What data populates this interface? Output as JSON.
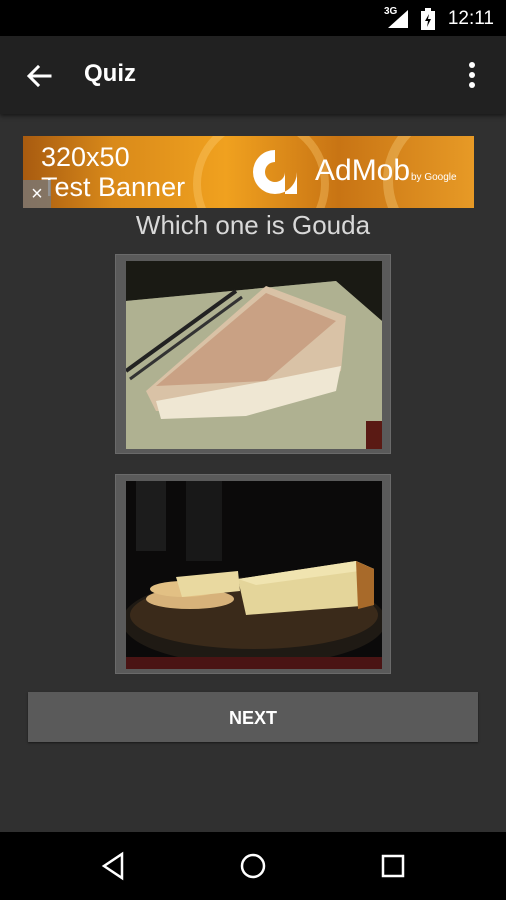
{
  "status_bar": {
    "network": "3G",
    "time": "12:11",
    "icons": [
      "signal-icon",
      "battery-icon"
    ]
  },
  "app_bar": {
    "title": "Quiz",
    "back_icon": "back-arrow-icon",
    "menu_icon": "more-vert-icon"
  },
  "ad": {
    "size_text": "320x50",
    "label_text": "Test Banner",
    "close_glyph": "×",
    "brand": "AdMob",
    "brand_sub": "by Google"
  },
  "quiz": {
    "question": "Which one is Gouda",
    "choices": [
      {
        "image": "cheese-wedge-on-plate-with-fork"
      },
      {
        "image": "cheese-block-with-crackers-on-board"
      }
    ],
    "next_label": "NEXT"
  },
  "nav_bar": {
    "icons": [
      "back-triangle-icon",
      "home-circle-icon",
      "recents-square-icon"
    ]
  },
  "colors": {
    "background": "#303030",
    "app_bar": "#212121",
    "button": "#5a5a5a"
  }
}
